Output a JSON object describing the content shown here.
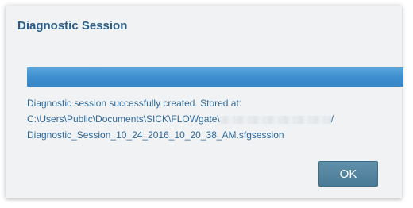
{
  "dialog": {
    "title": "Diagnostic Session",
    "progress": {
      "value_percent": 100,
      "fill_color": "#3e8fcf"
    },
    "message": {
      "line1": "Diagnostic session successfully created. Stored at:",
      "line2_prefix": "C:\\Users\\Public\\Documents\\SICK\\FLOWgate\\",
      "line2_suffix": "/",
      "line3": "Diagnostic_Session_10_24_2016_10_20_38_AM.sfgsession"
    },
    "ok_label": "OK"
  },
  "colors": {
    "title": "#2a5d89",
    "message_text": "#2d6a9f",
    "button": "#4a7b96",
    "dialog_background": "#f1f2f3"
  }
}
